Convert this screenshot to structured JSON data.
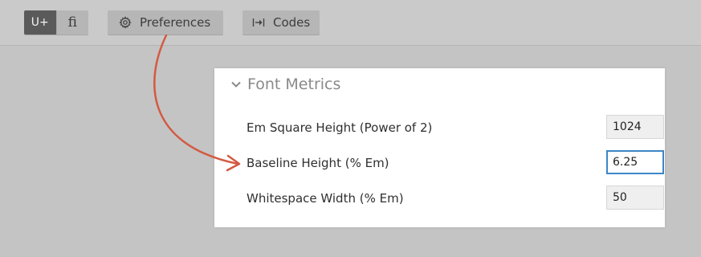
{
  "toolbar": {
    "mode_toggle": {
      "unicode_label": "U+",
      "ligature_label": "fi"
    },
    "preferences_label": "Preferences",
    "codes_label": "Codes",
    "icons": {
      "preferences": "gear-icon",
      "codes": "tab-arrow-icon"
    }
  },
  "panel": {
    "section_title": "Font Metrics",
    "fields": [
      {
        "label": "Em Square Height (Power of 2)",
        "value": "1024"
      },
      {
        "label": "Baseline Height (% Em)",
        "value": "6.25"
      },
      {
        "label": "Whitespace Width (% Em)",
        "value": "50"
      }
    ]
  },
  "colors": {
    "annotation_arrow": "#d35a42",
    "focus_ring": "#3e86c6",
    "active_toggle": "#5a5a5a"
  }
}
